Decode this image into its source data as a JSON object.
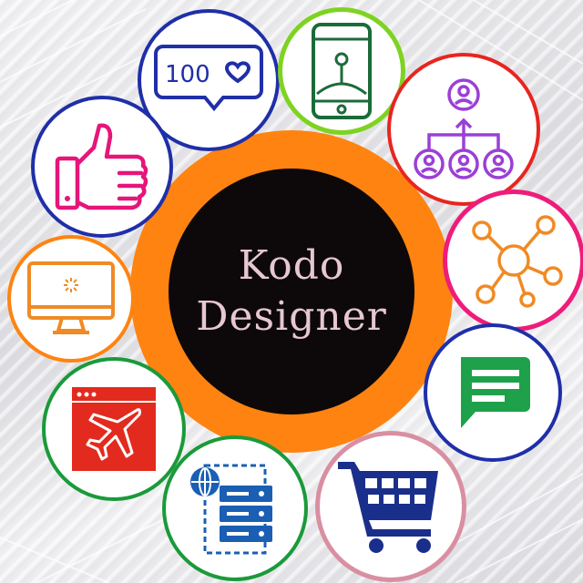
{
  "brand": {
    "line1": "Kodo",
    "line2": "Designer"
  },
  "notification_badge": {
    "count_text": "100"
  },
  "icons": [
    {
      "name": "like-notification-icon",
      "ring_color": "#1f2fa8"
    },
    {
      "name": "mobile-navigation-icon",
      "ring_color": "#7ed321"
    },
    {
      "name": "organization-chart-icon",
      "ring_color": "#e8251f"
    },
    {
      "name": "network-hub-icon",
      "ring_color": "#ee1c7a"
    },
    {
      "name": "chat-message-icon",
      "ring_color": "#1f2fa8"
    },
    {
      "name": "shopping-cart-icon",
      "ring_color": "#d98fa2"
    },
    {
      "name": "web-server-icon",
      "ring_color": "#1a9a3a"
    },
    {
      "name": "flight-booking-icon",
      "ring_color": "#1a9a3a"
    },
    {
      "name": "desktop-computer-icon",
      "ring_color": "#ff8311"
    },
    {
      "name": "thumbs-up-icon",
      "ring_color": "#1f2fa8"
    }
  ],
  "colors": {
    "hub_ring": "#ff8311",
    "hub_center": "#0d090b",
    "brand_text": "#e6c7d2"
  }
}
